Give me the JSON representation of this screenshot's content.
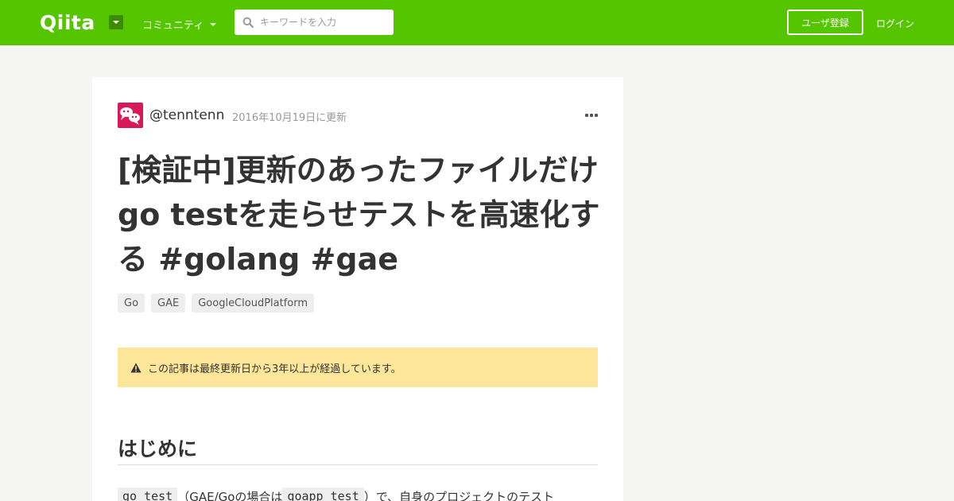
{
  "header": {
    "logo_text": "Qiita",
    "community_label": "コミュニティ",
    "search_placeholder": "キーワードを入力",
    "signup_label": "ユーザ登録",
    "login_label": "ログイン",
    "background_color": "#55c500"
  },
  "article": {
    "author": "@tenntenn",
    "updated": "2016年10月19日に更新",
    "title": "[検証中]更新のあったファイルだけgo testを走らせテストを高速化する #golang #gae",
    "tags": [
      "Go",
      "GAE",
      "GoogleCloudPlatform"
    ],
    "notice": "この記事は最終更新日から3年以上が経過しています。",
    "notice_color": "#fde59a",
    "section_heading": "はじめに",
    "body": {
      "code1": "go test",
      "text1": "（GAE/Goの場合は",
      "code2": "goapp test",
      "text2": "）で、自身のプロジェクトのテスト"
    }
  },
  "icons": {
    "search": "search-icon",
    "more": "more-icon",
    "warning": "warning-icon",
    "dropdown": "chevron-down-icon"
  }
}
